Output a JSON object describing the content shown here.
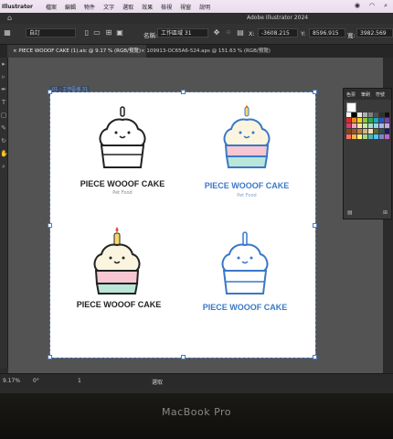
{
  "menubar": {
    "app": "Illustrator",
    "items": [
      "檔案",
      "編輯",
      "物件",
      "文字",
      "選取",
      "效果",
      "檢視",
      "視窗",
      "說明"
    ]
  },
  "titlebar": {
    "title": "Adobe Illustrator 2024"
  },
  "controlbar": {
    "preset": "自訂",
    "name_label": "名稱:",
    "name_value": "工作區域 31",
    "x_label": "X:",
    "x_value": "-3608.215",
    "y_label": "Y:",
    "y_value": "8596.915",
    "w_label": "寬:",
    "w_value": "3982.569"
  },
  "tabs": [
    {
      "label": "PIECE WOOOF CAKE (1).aic @ 9.17 % (RGB/預覽)"
    },
    {
      "label": "109913-OC65A6-524.aps @ 151.63 % (RGB/預覽)"
    }
  ],
  "canvas": {
    "artboard_label": "01 - 工作區域 31",
    "logos": [
      {
        "brand": "PIECE WOOOF CAKE",
        "sub": "Pet Food",
        "style": "outline"
      },
      {
        "brand": "PIECE WOOOF CAKE",
        "sub": "Pet Food",
        "style": "color-blue"
      },
      {
        "brand": "PIECE WOOOF CAKE",
        "sub": "",
        "style": "color"
      },
      {
        "brand": "PIECE WOOOF CAKE",
        "sub": "",
        "style": "blue"
      }
    ]
  },
  "swatch_panel": {
    "tabs": [
      "色票",
      "筆刷",
      "符號"
    ],
    "colors": [
      "#ffffff",
      "#000000",
      "#e8e8e8",
      "#b0b0b0",
      "#808080",
      "#505050",
      "#303030",
      "#101010",
      "#e6261f",
      "#f08a1c",
      "#f7d117",
      "#8cc63e",
      "#2fa84f",
      "#17a9c8",
      "#2b59c3",
      "#7a3fb0",
      "#d63a6e",
      "#f3a4b6",
      "#fbe5a1",
      "#c8e6a0",
      "#a8dcc8",
      "#9fd0ea",
      "#a9b7e4",
      "#c6a9de",
      "#8b4513",
      "#a0522d",
      "#c08040",
      "#d2b48c",
      "#f5deb3",
      "#556b2f",
      "#2f4f4f",
      "#191970",
      "#ff6f61",
      "#ffb347",
      "#fff176",
      "#aed581",
      "#4db6ac",
      "#4fc3f7",
      "#7986cb",
      "#ba68c8"
    ]
  },
  "statusbar": {
    "zoom": "9.17%",
    "angle": "0°",
    "page": "1",
    "mode": "選取"
  },
  "bezel": {
    "model": "MacBook Pro"
  }
}
